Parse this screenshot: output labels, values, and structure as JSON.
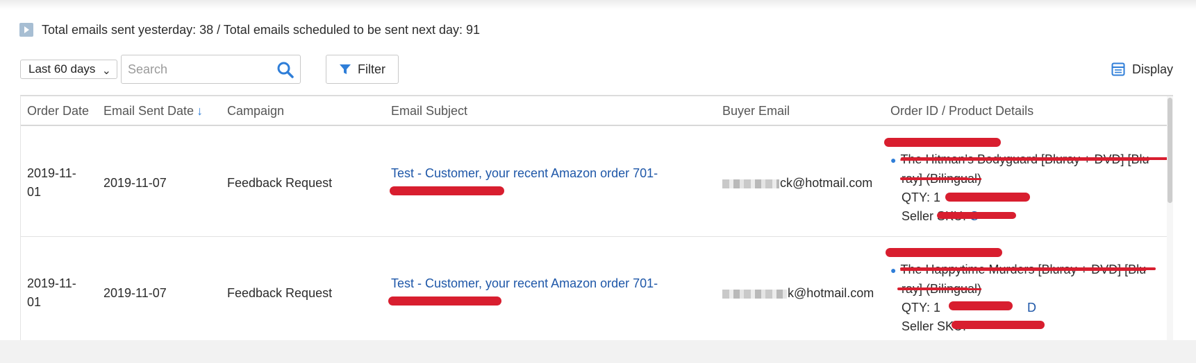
{
  "summary": {
    "text": "Total emails sent yesterday: 38 / Total emails scheduled to be sent next day: 91"
  },
  "toolbar": {
    "date_range": "Last 60 days",
    "search_placeholder": "Search",
    "filter_label": "Filter",
    "display_label": "Display"
  },
  "table": {
    "columns": [
      "Order Date",
      "Email Sent Date",
      "Campaign",
      "Email Subject",
      "Buyer Email",
      "Order ID / Product Details"
    ],
    "sort_indicator": "↓",
    "rows": [
      {
        "order_date_1": "2019-11-",
        "order_date_2": "01",
        "email_sent_date": "2019-11-07",
        "campaign": "Feedback Request",
        "subject_line1": "Test - Customer, your recent Amazon order 701-",
        "buyer_email": "ck@hotmail.com",
        "product_line1": "The Hitman's Bodyguard [Bluray + DVD] [Blu",
        "product_line2": "ray] (Bilingual)",
        "qty_label": "QTY: 1",
        "seller_sku_label": "Seller SKU: ",
        "seller_sku_prefix": "C"
      },
      {
        "order_date_1": "2019-11-",
        "order_date_2": "01",
        "email_sent_date": "2019-11-07",
        "campaign": "Feedback Request",
        "subject_line1": "Test - Customer, your recent Amazon order 701-",
        "buyer_email": "k@hotmail.com",
        "product_line1": "The Happytime Murders [Bluray + DVD] [Blu",
        "product_line2": "ray] (Bilingual)",
        "qty_label": "QTY: 1",
        "asin_suffix": "D",
        "seller_sku_label": "Seller SKU: "
      }
    ]
  },
  "colors": {
    "link": "#1e57a8",
    "accent": "#2f7ed8",
    "redaction": "#d81e2f"
  },
  "icons": [
    "play-icon",
    "chevron-down-icon",
    "search-icon",
    "filter-icon",
    "display-icon",
    "sort-arrow-down-icon"
  ]
}
